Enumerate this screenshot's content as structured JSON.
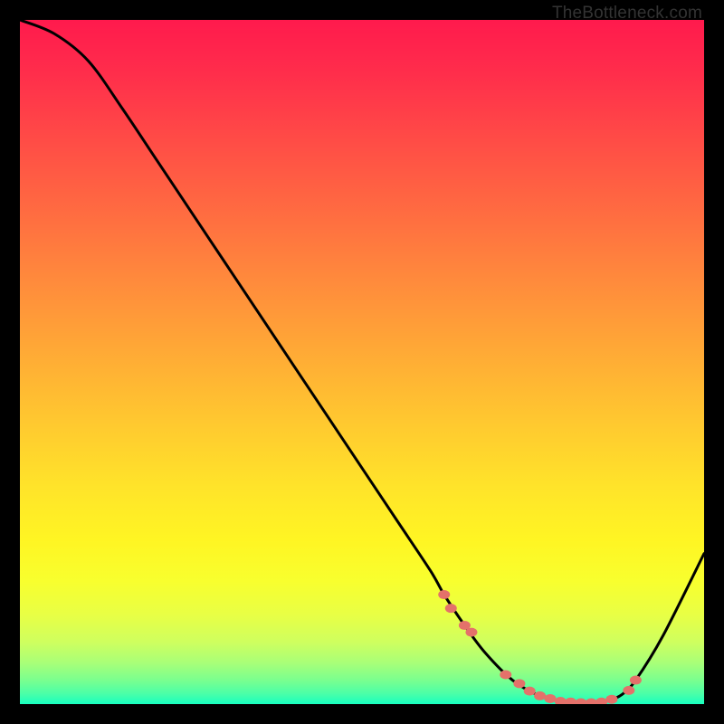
{
  "watermark": "TheBottleneck.com",
  "chart_data": {
    "type": "line",
    "title": "",
    "xlabel": "",
    "ylabel": "",
    "xlim": [
      0,
      100
    ],
    "ylim": [
      0,
      100
    ],
    "grid": false,
    "series": [
      {
        "name": "curve",
        "x": [
          0,
          5,
          10,
          15,
          20,
          25,
          30,
          35,
          40,
          45,
          50,
          55,
          60,
          62,
          65,
          68,
          72,
          76,
          80,
          84,
          86,
          88,
          90,
          94,
          100
        ],
        "y": [
          100,
          98,
          94,
          87,
          79.5,
          72,
          64.5,
          57,
          49.5,
          42,
          34.5,
          27,
          19.5,
          16,
          11.5,
          7.5,
          3.5,
          1.2,
          0.3,
          0.2,
          0.5,
          1.4,
          3.5,
          10,
          22
        ],
        "color": "#000000"
      }
    ],
    "markers": {
      "name": "bottom-markers",
      "color": "#e4716a",
      "points": [
        {
          "x": 62,
          "y": 16
        },
        {
          "x": 63,
          "y": 14
        },
        {
          "x": 65,
          "y": 11.5
        },
        {
          "x": 66,
          "y": 10.5
        },
        {
          "x": 71,
          "y": 4.3
        },
        {
          "x": 73,
          "y": 3
        },
        {
          "x": 74.5,
          "y": 1.9
        },
        {
          "x": 76,
          "y": 1.2
        },
        {
          "x": 77.5,
          "y": 0.8
        },
        {
          "x": 79,
          "y": 0.4
        },
        {
          "x": 80.5,
          "y": 0.3
        },
        {
          "x": 82,
          "y": 0.2
        },
        {
          "x": 83.5,
          "y": 0.2
        },
        {
          "x": 85,
          "y": 0.3
        },
        {
          "x": 86.5,
          "y": 0.7
        },
        {
          "x": 89,
          "y": 2
        },
        {
          "x": 90,
          "y": 3.5
        }
      ]
    },
    "gradient": {
      "stops": [
        {
          "offset": 0.0,
          "color": "#ff1a4d"
        },
        {
          "offset": 0.08,
          "color": "#ff2e4b"
        },
        {
          "offset": 0.18,
          "color": "#ff4d46"
        },
        {
          "offset": 0.28,
          "color": "#ff6b41"
        },
        {
          "offset": 0.38,
          "color": "#ff8a3c"
        },
        {
          "offset": 0.48,
          "color": "#ffa836"
        },
        {
          "offset": 0.58,
          "color": "#ffc630"
        },
        {
          "offset": 0.68,
          "color": "#ffe32a"
        },
        {
          "offset": 0.76,
          "color": "#fff523"
        },
        {
          "offset": 0.82,
          "color": "#f8ff2e"
        },
        {
          "offset": 0.87,
          "color": "#e8ff45"
        },
        {
          "offset": 0.91,
          "color": "#ceff5f"
        },
        {
          "offset": 0.94,
          "color": "#a8ff78"
        },
        {
          "offset": 0.965,
          "color": "#7aff8f"
        },
        {
          "offset": 0.985,
          "color": "#4affa8"
        },
        {
          "offset": 1.0,
          "color": "#18ffc0"
        }
      ]
    }
  }
}
